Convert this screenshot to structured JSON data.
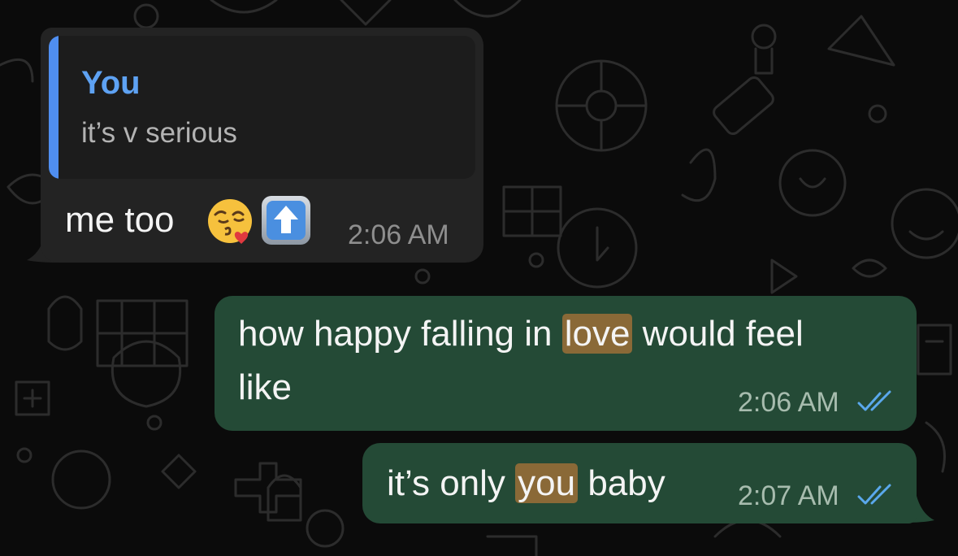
{
  "colors": {
    "incoming_bubble": "#232323",
    "outgoing_bubble": "#244a36",
    "quote_accent": "#4f8ef0",
    "highlight": "#8a6937",
    "read_ticks": "#5aa8ec"
  },
  "incoming": {
    "quote": {
      "author": "You",
      "text": "it’s v serious"
    },
    "text": "me too",
    "emojis": [
      "face-blowing-kiss",
      "up-arrow-button"
    ],
    "time": "2:06 AM"
  },
  "outgoing": [
    {
      "line1_before": "how happy falling in ",
      "highlight": "love",
      "line1_after": " would feel",
      "line2": "like",
      "time": "2:06 AM",
      "status_icon": "double-check-read"
    },
    {
      "before": "it’s only ",
      "highlight": "you",
      "after": " baby",
      "time": "2:07 AM",
      "status_icon": "double-check-read"
    }
  ]
}
